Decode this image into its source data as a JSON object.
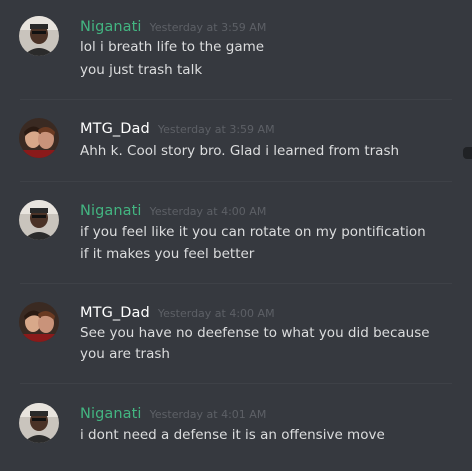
{
  "colors": {
    "background": "#36393f",
    "green_name": "#43b581",
    "white_name": "#ffffff",
    "timestamp": "#5d6066",
    "text": "#dcddde"
  },
  "messages": [
    {
      "author": "Niganati",
      "author_color": "green",
      "timestamp": "Yesterday at 3:59 AM",
      "lines": [
        "lol i breath life to the game",
        "you just trash talk"
      ]
    },
    {
      "author": "MTG_Dad",
      "author_color": "white",
      "timestamp": "Yesterday at 3:59 AM",
      "lines": [
        "Ahh k.  Cool story bro.  Glad i learned from trash"
      ]
    },
    {
      "author": "Niganati",
      "author_color": "green",
      "timestamp": "Yesterday at 4:00 AM",
      "lines": [
        "if you feel like it you can rotate on my pontification",
        "if it makes you feel better"
      ]
    },
    {
      "author": "MTG_Dad",
      "author_color": "white",
      "timestamp": "Yesterday at 4:00 AM",
      "lines": [
        "See you have no deefense to what you did because",
        "you are trash"
      ]
    },
    {
      "author": "Niganati",
      "author_color": "green",
      "timestamp": "Yesterday at 4:01 AM",
      "lines": [
        "i dont need a defense it is an offensive move"
      ]
    }
  ]
}
